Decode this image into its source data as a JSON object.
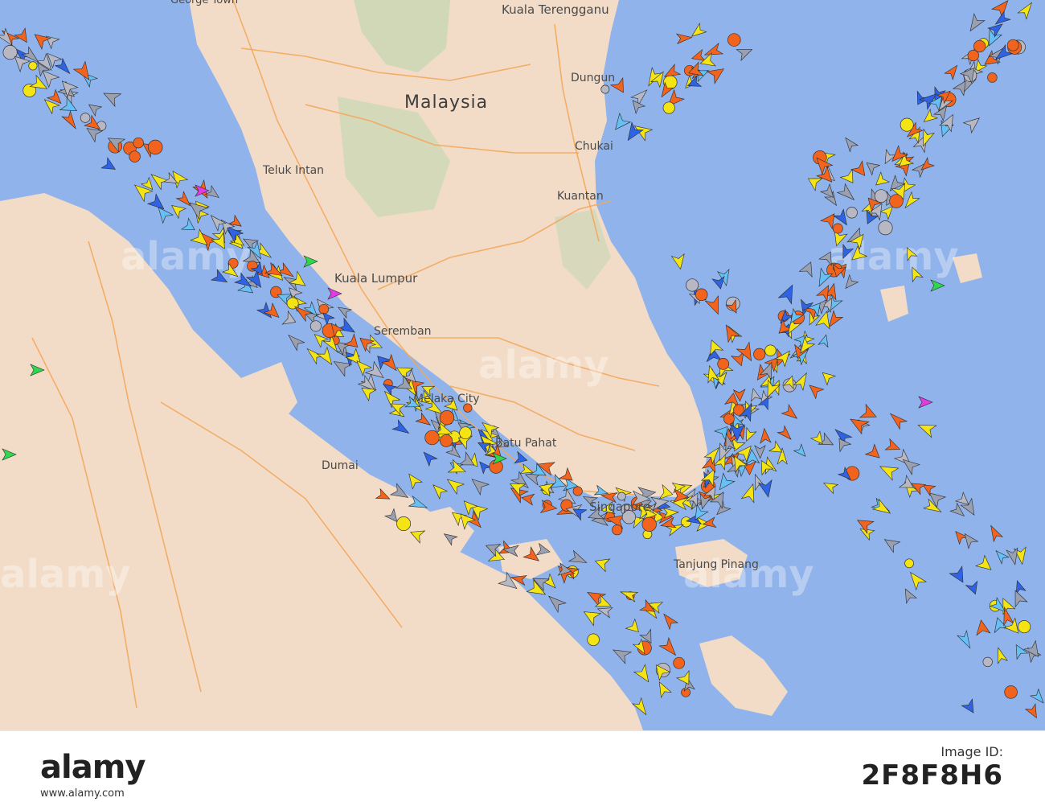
{
  "map": {
    "country_label": "Malaysia",
    "places": [
      {
        "name": "Kuala Terengganu"
      },
      {
        "name": "George Town"
      },
      {
        "name": "Dungun"
      },
      {
        "name": "Chukai"
      },
      {
        "name": "Kuantan"
      },
      {
        "name": "Teluk Intan"
      },
      {
        "name": "Kuala Lumpur"
      },
      {
        "name": "Seremban"
      },
      {
        "name": "Melaka City"
      },
      {
        "name": "Batu Pahat"
      },
      {
        "name": "Dumai"
      },
      {
        "name": "Singapore"
      },
      {
        "name": "Tanjung Pinang"
      }
    ],
    "watermark": "alamy",
    "colors": {
      "sea": "#8fb3ea",
      "land": "#f2dcc8",
      "forest": "#c7d7b4",
      "road": "#f3a75c",
      "cargo": "#f5e414",
      "tanker": "#f2641e",
      "passenger": "#2f63e6",
      "fishing": "#9aa0b0",
      "tug": "#66c0f5",
      "pleasure": "#e23be2",
      "hsc": "#2ed84a",
      "anchored": "#b8b8c4"
    }
  },
  "stock": {
    "logo": "alamy",
    "image_id_label": "Image ID:",
    "image_id": "2F8F8H6",
    "url": "www.alamy.com"
  }
}
